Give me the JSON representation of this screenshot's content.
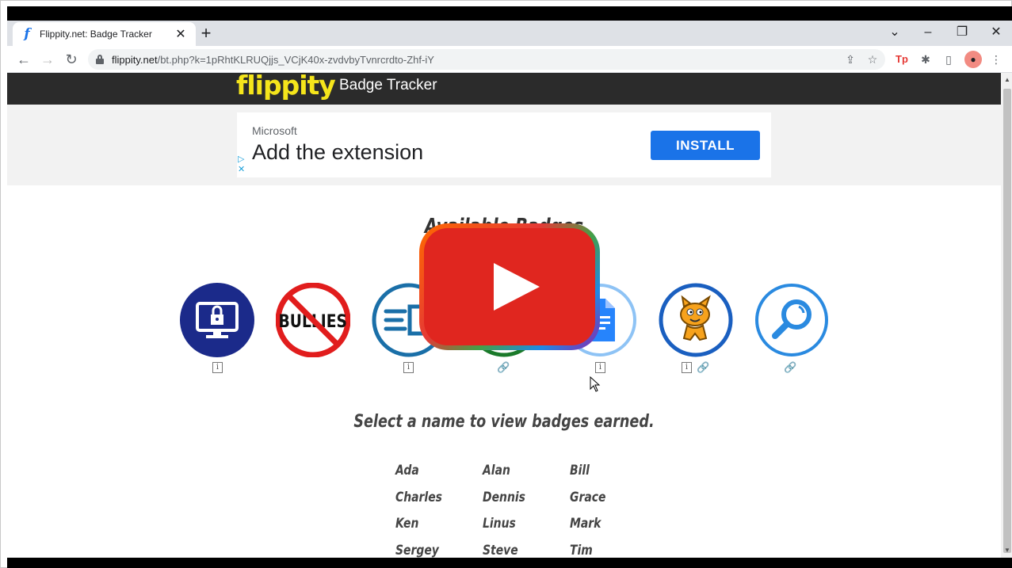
{
  "browser": {
    "tab_title": "Flippity.net: Badge Tracker",
    "tab_favicon": "f",
    "new_tab_label": "+",
    "url_host": "flippity.net",
    "url_path": "/bt.php?k=1pRhtKLRUQjjs_VCjK40x-zvdvbyTvnrcrdto-Zhf-iY",
    "window_controls": [
      "chevron-down-icon",
      "minimize-icon",
      "restore-icon",
      "close-icon"
    ],
    "extension_tp_label": "Tp"
  },
  "site": {
    "logo": "flippity",
    "title": "Badge Tracker",
    "logo_color": "#f5e51b",
    "header_color": "#2b2b2b"
  },
  "ad": {
    "brand": "Microsoft",
    "headline": "Add the extension",
    "button": "INSTALL",
    "button_color": "#1a73e8"
  },
  "content": {
    "title": "Available Badges",
    "select_prompt": "Select a name to view badges earned.",
    "badges": [
      {
        "name": "security-monitor-badge",
        "info": true,
        "link": false
      },
      {
        "name": "no-bullies-badge",
        "info": false,
        "link": false
      },
      {
        "name": "document-edit-badge",
        "info": true,
        "link": false
      },
      {
        "name": "hidden-badge",
        "info": false,
        "link": true
      },
      {
        "name": "google-docs-badge",
        "info": true,
        "link": false
      },
      {
        "name": "scratch-cat-badge",
        "info": true,
        "link": true
      },
      {
        "name": "search-badge",
        "info": false,
        "link": true
      }
    ],
    "bullies_text": "BULLIES",
    "names": [
      "Ada",
      "Alan",
      "Bill",
      "Charles",
      "Dennis",
      "Grace",
      "Ken",
      "Linus",
      "Mark",
      "Sergey",
      "Steve",
      "Tim"
    ]
  },
  "overlay": {
    "icon": "youtube-play-button"
  }
}
